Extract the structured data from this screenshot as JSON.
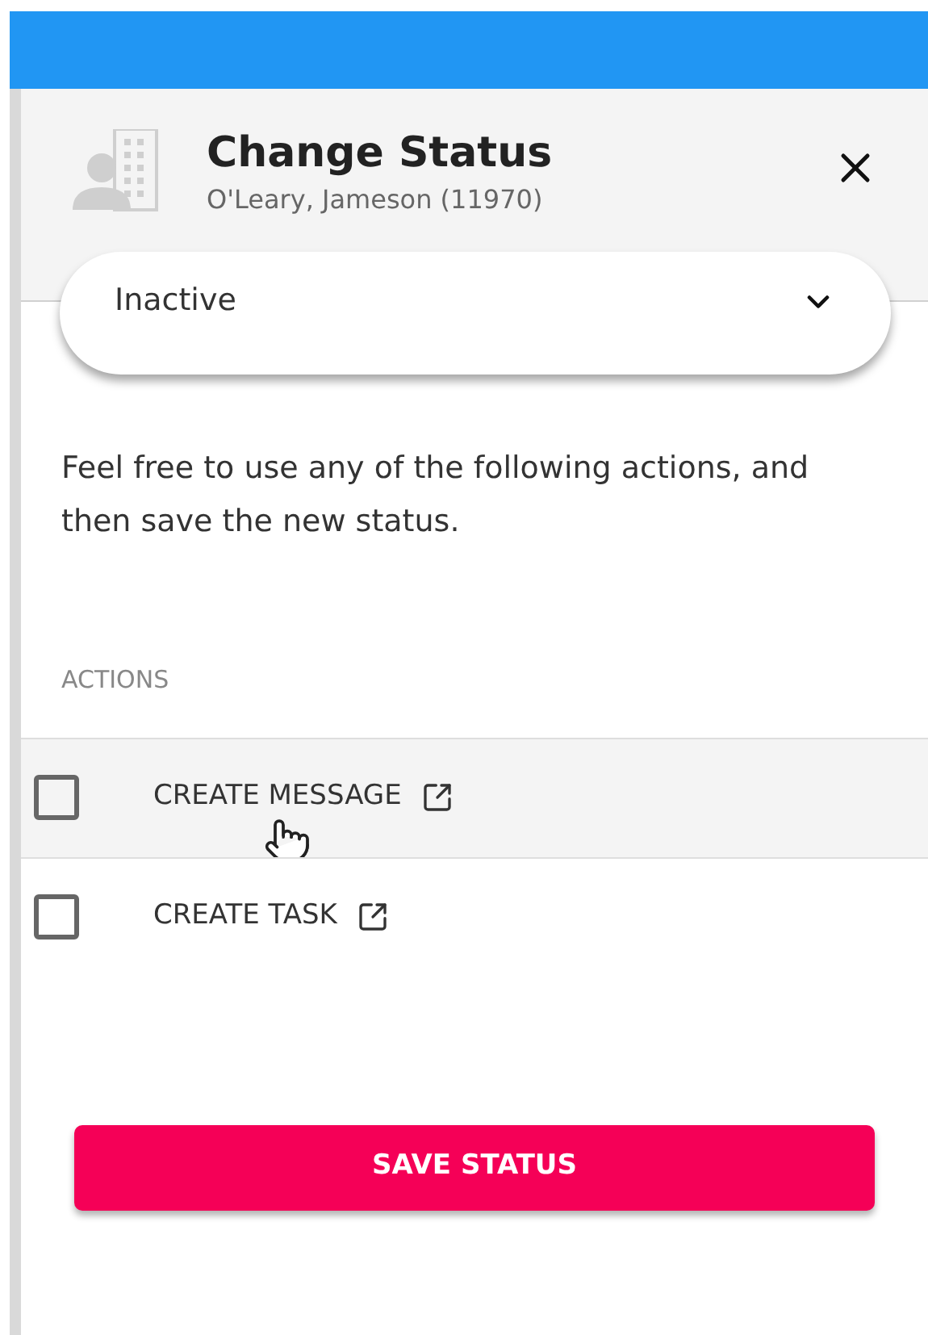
{
  "header": {
    "title": "Change Status",
    "subtitle": "O'Leary, Jameson (11970)"
  },
  "status_select": {
    "value": "Inactive"
  },
  "intro": "Feel free to use any of the following actions, and then save the new status.",
  "actions_heading": "ACTIONS",
  "actions": [
    {
      "label": "CREATE MESSAGE",
      "checked": false,
      "hovered": true
    },
    {
      "label": "CREATE TASK",
      "checked": false,
      "hovered": false
    }
  ],
  "save_button": "SAVE STATUS"
}
